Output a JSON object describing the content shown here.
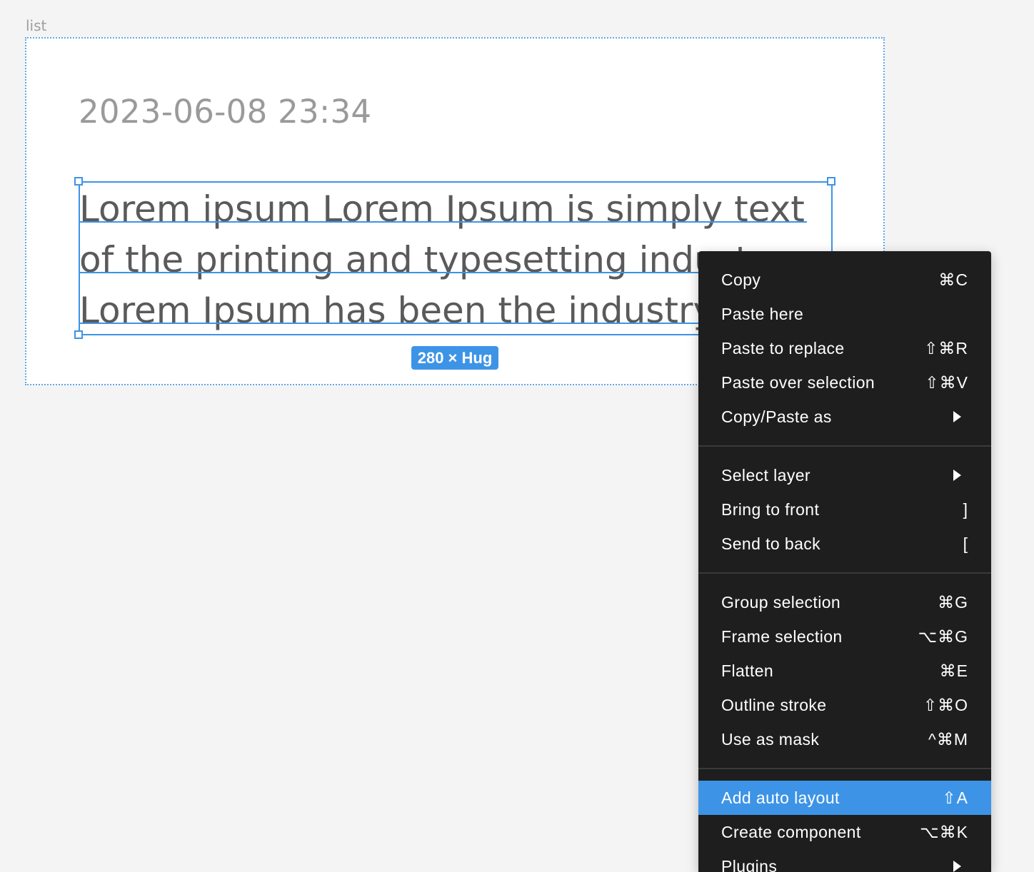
{
  "canvas": {
    "frame_label": "list",
    "timestamp": "2023-06-08 23:34",
    "body_lines": [
      "Lorem ipsum Lorem Ipsum is simply text",
      "of the printing and typesetting industry.",
      "Lorem Ipsum has been the industry's"
    ],
    "size_badge": "280 × Hug"
  },
  "menu": {
    "groups": [
      [
        {
          "label": "Copy",
          "shortcut": "⌘C"
        },
        {
          "label": "Paste here",
          "shortcut": ""
        },
        {
          "label": "Paste to replace",
          "shortcut": "⇧⌘R"
        },
        {
          "label": "Paste over selection",
          "shortcut": "⇧⌘V"
        },
        {
          "label": "Copy/Paste as",
          "submenu": true
        }
      ],
      [
        {
          "label": "Select layer",
          "submenu": true
        },
        {
          "label": "Bring to front",
          "shortcut": "]"
        },
        {
          "label": "Send to back",
          "shortcut": "["
        }
      ],
      [
        {
          "label": "Group selection",
          "shortcut": "⌘G"
        },
        {
          "label": "Frame selection",
          "shortcut": "⌥⌘G"
        },
        {
          "label": "Flatten",
          "shortcut": "⌘E"
        },
        {
          "label": "Outline stroke",
          "shortcut": "⇧⌘O"
        },
        {
          "label": "Use as mask",
          "shortcut": "^⌘M"
        }
      ],
      [
        {
          "label": "Add auto layout",
          "shortcut": "⇧A",
          "active": true
        },
        {
          "label": "Create component",
          "shortcut": "⌥⌘K"
        },
        {
          "label": "Plugins",
          "submenu": true
        }
      ]
    ]
  },
  "colors": {
    "selection": "#3d94e6",
    "menu_bg": "#1e1e1e",
    "highlight": "#3d94e6"
  }
}
